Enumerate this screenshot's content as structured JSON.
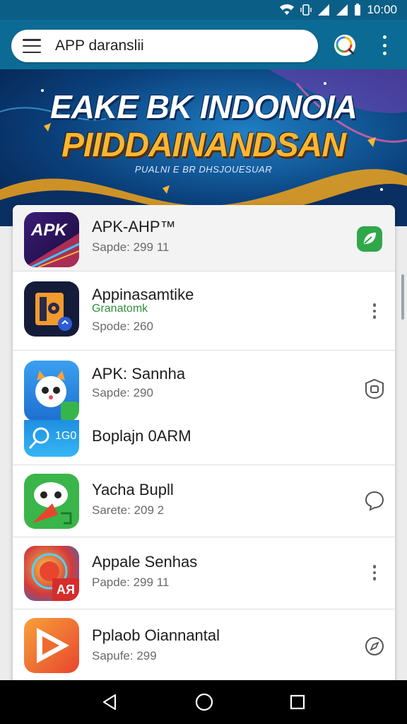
{
  "status_bar": {
    "time": "10:00"
  },
  "app_bar": {
    "search_text": "APP daranslii"
  },
  "banner": {
    "title_line1": "EAKE BK INDONOIA",
    "title_line2": "PIIDDAINANDSAN",
    "subtitle": "PUALNI E BR DHSJOUESUAR"
  },
  "apps": [
    {
      "name": "APK-AHP™",
      "sub": "Sapde: 299 11",
      "icon_text": "APK",
      "action_icon": "leaf-badge-icon"
    },
    {
      "name": "Appinasamtike",
      "sub_green": "Granatomk",
      "sub": "Spode: 260",
      "action_icon": "more-vert-icon"
    },
    {
      "name": "APK: Sannha",
      "sub": "Sapde: 290",
      "second_name": "Boplajn 0ARM",
      "icon_text": "1G0",
      "action_icon": "shield-icon"
    },
    {
      "name": "Yacha Bupll",
      "sub": "Sarete: 209 2",
      "action_icon": "chat-bubble-icon"
    },
    {
      "name": "Appale Senhas",
      "sub": "Papde: 299 11",
      "icon_text": "AЯ",
      "action_icon": "more-vert-icon"
    },
    {
      "name": "Pplaob Oiannantal",
      "sub": "Sapufe: 299",
      "action_icon": "compass-icon"
    }
  ]
}
